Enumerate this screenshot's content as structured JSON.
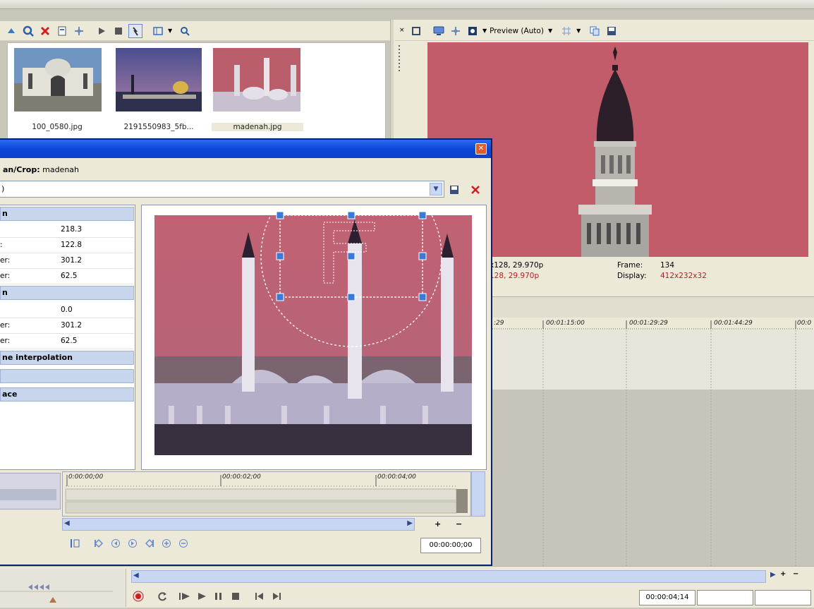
{
  "media": {
    "files": [
      {
        "name": "100_0580.jpg"
      },
      {
        "name": "2191550983_5fb..."
      },
      {
        "name": "madenah.jpg"
      }
    ]
  },
  "preview": {
    "mode_label": "Preview (Auto)",
    "info_left_line1": "x128, 29.970p",
    "info_left_line2": "128, 29.970p",
    "frame_label": "Frame:",
    "frame_value": "134",
    "display_label": "Display:",
    "display_value": "412x232x32"
  },
  "timeline": {
    "ruler": [
      ":29",
      "00:01:15:00",
      "00:01:29:29",
      "00:01:44:29",
      "00:0"
    ],
    "current_time": "00:00:04;14"
  },
  "dialog": {
    "title": "",
    "caption_bold": "an/Crop:",
    "caption_name": "madenah",
    "preset_value": ")",
    "sections": {
      "s1": "n",
      "s2": "n",
      "s3": "ne interpolation",
      "s4": "",
      "s5": "ace"
    },
    "props": [
      {
        "key": "",
        "value": "218.3"
      },
      {
        "key": ":",
        "value": "122.8"
      },
      {
        "key": "er:",
        "value": "301.2"
      },
      {
        "key": "er:",
        "value": "62.5"
      },
      {
        "key": "",
        "value": "0.0"
      },
      {
        "key": "er:",
        "value": "301.2"
      },
      {
        "key": "er:",
        "value": "62.5"
      }
    ],
    "ruler": [
      "0:00:00;00",
      "00:00:02;00",
      "00:00:04;00"
    ],
    "current_time": "00:00:00;00"
  }
}
